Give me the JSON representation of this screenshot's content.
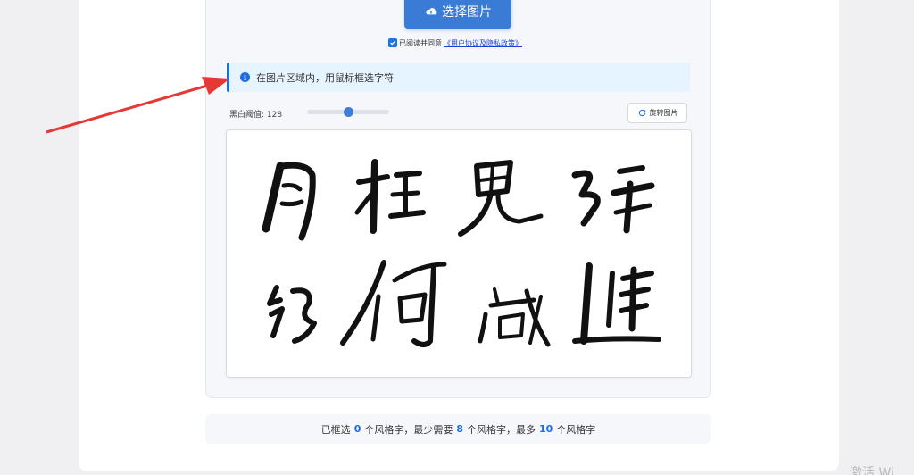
{
  "upload": {
    "select_label": "选择图片",
    "agree_prefix": "已阅读并同意",
    "agree_link": "《用户协议及隐私政策》",
    "agree_checked": true
  },
  "info": {
    "text": "在图片区域内，用鼠标框选字符"
  },
  "controls": {
    "threshold_label": "黑白阈值: 128",
    "threshold_value": 128,
    "threshold_max": 255,
    "rotate_label": "旋转图片"
  },
  "footer": {
    "part1": "已框选",
    "selected": "0",
    "part2": "个风格字，最少需要",
    "min": "8",
    "part3": "个风格字，最多",
    "max": "10",
    "part4": "个风格字"
  },
  "watermark": {
    "text": "激活 Wi"
  },
  "colors": {
    "accent": "#1d6fe0",
    "button": "#3a7bd5",
    "arrow": "#e53935"
  }
}
